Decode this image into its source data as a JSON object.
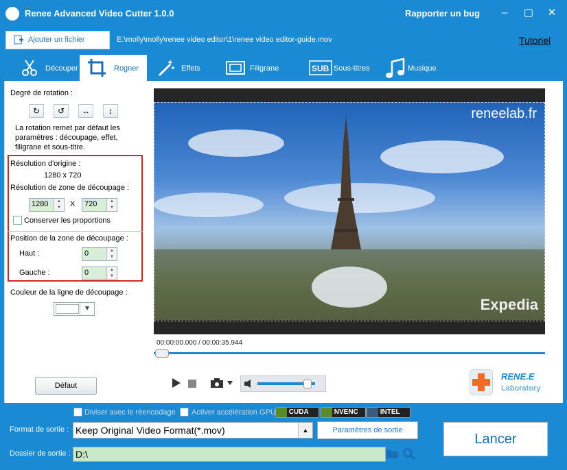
{
  "window": {
    "title": "Renee Advanced Video Cutter 1.0.0",
    "bug_link": "Rapporter un bug",
    "minimize": "–",
    "maximize": "▢",
    "close": "✕"
  },
  "toolbar": {
    "add_file": "Ajouter un fichier",
    "file_path": "E:\\molly\\molly\\renee video editor\\1\\renee video editor-guide.mov",
    "tutorial": "Tutoriel"
  },
  "tabs": [
    {
      "label": "Découper",
      "icon": "scissors-icon"
    },
    {
      "label": "Rogner",
      "icon": "crop-icon"
    },
    {
      "label": "Effets",
      "icon": "magic-wand-icon"
    },
    {
      "label": "Filigrane",
      "icon": "watermark-icon"
    },
    {
      "label": "Sous-titres",
      "icon": "subtitle-icon"
    },
    {
      "label": "Musique",
      "icon": "music-note-icon"
    }
  ],
  "crop_panel": {
    "rotation_label": "Degré de rotation :",
    "rotation_note": [
      "La rotation remet par défaut les",
      "paramètres : découpage, effet,",
      "filigrane et sous-titre."
    ],
    "original_resolution_label": "Résolution d'origine :",
    "original_resolution": "1280 x 720",
    "crop_resolution_label": "Résolution de zone de découpage :",
    "crop_width": "1280",
    "crop_x": "X",
    "crop_height": "720",
    "keep_proportions": "Conserver les proportions",
    "position_label": "Position de la zone de découpage :",
    "top_label": "Haut :",
    "top_value": "0",
    "left_label": "Gauche :",
    "left_value": "0",
    "line_color_label": "Couleur de la ligne de découpage :",
    "default_button": "Défaut"
  },
  "preview": {
    "watermark_top": "reneelab.fr",
    "watermark_bottom": "Expedia"
  },
  "player": {
    "time": "00:00:00.000 / 00:00:35.944",
    "volume": 0.86
  },
  "brand": {
    "name": "RENE.E",
    "sub": "Laboratory"
  },
  "bottom": {
    "split_reencode": "Diviser avec le réencodage",
    "gpu_accel": "Activer accélération GPU",
    "badges": [
      "CUDA",
      "NVENC",
      "INTEL"
    ],
    "format_label": "Format de sortie :",
    "format_value": "Keep Original Video Format(*.mov)",
    "params_button": "Paramètres de sortie",
    "folder_label": "Dossier de sortie :",
    "folder_value": "D:\\",
    "launch_button": "Lancer"
  },
  "colors": {
    "accent": "#1a8ad4",
    "highlight": "#d22222"
  }
}
